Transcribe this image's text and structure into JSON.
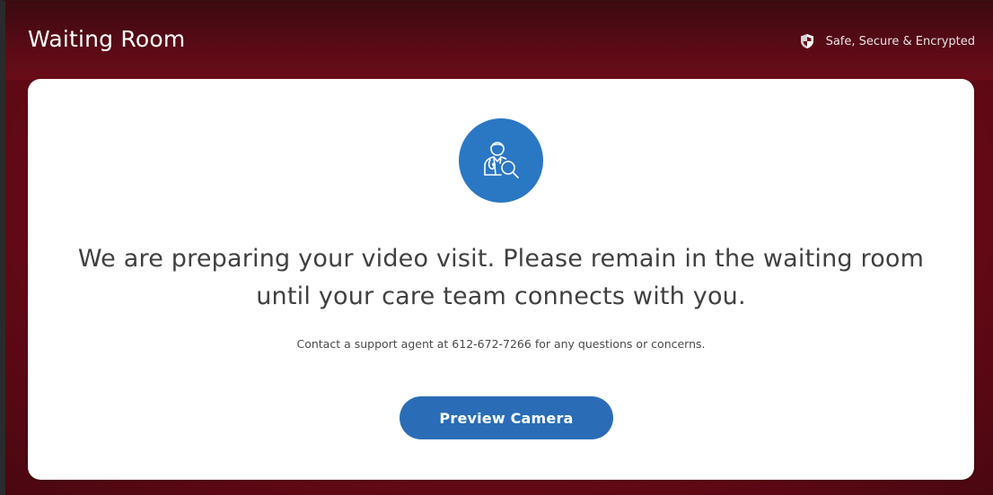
{
  "header": {
    "title": "Waiting Room",
    "security_label": "Safe, Secure & Encrypted",
    "security_icon": "shield-icon"
  },
  "main": {
    "icon": "doctor-search-icon",
    "headline_line1": "We are preparing your video visit. Please remain in the waiting room",
    "headline_line2": "until your care team connects with you.",
    "contact_text": "Contact a support agent at 612-672-7266 for any questions or concerns.",
    "button_label": "Preview Camera"
  },
  "colors": {
    "header_bg": "#5a0b16",
    "page_bg": "#6e0a18",
    "card_bg": "#ffffff",
    "accent": "#2a6db6",
    "icon_circle": "#2a77c4",
    "text_primary": "#404040"
  }
}
